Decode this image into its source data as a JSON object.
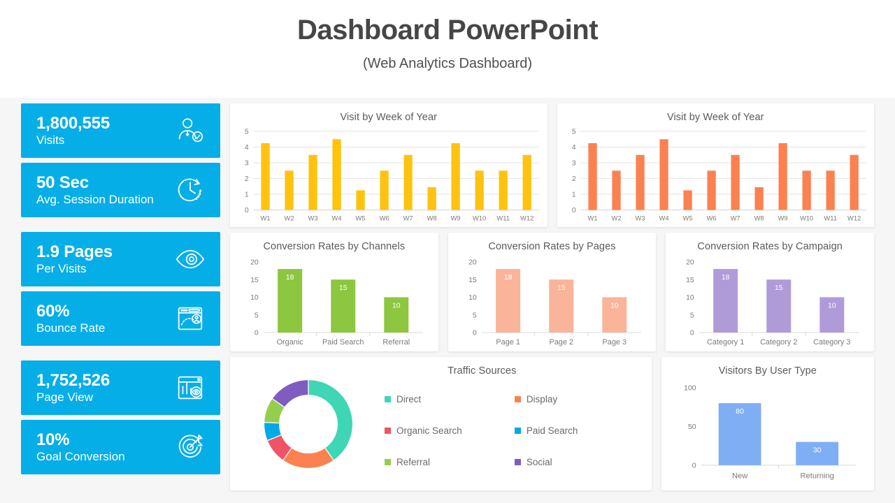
{
  "header": {
    "title": "Dashboard PowerPoint",
    "subtitle": "(Web Analytics Dashboard)"
  },
  "theme": {
    "accent": "#06AEE8",
    "page_bg": "#FFFFFF",
    "board_bg": "#F6F6F6",
    "panel_bg": "#FFFFFF",
    "title_color": "#464646"
  },
  "kpis": [
    {
      "value": "1,800,555",
      "label": "Visits",
      "icon": "user-check-icon"
    },
    {
      "value": "50 Sec",
      "label": "Avg. Session Duration",
      "icon": "clock-timer-icon"
    },
    {
      "value": "1.9 Pages",
      "label": "Per Visits",
      "icon": "eye-icon"
    },
    {
      "value": "60%",
      "label": "Bounce Rate",
      "icon": "browser-bounce-icon"
    },
    {
      "value": "1,752,526",
      "label": "Page View",
      "icon": "chart-eye-icon"
    },
    {
      "value": "10%",
      "label": "Goal Conversion",
      "icon": "target-arrow-icon"
    }
  ],
  "chart_data": [
    {
      "id": "visit_week_yellow",
      "type": "bar",
      "title": "Visit by Week of Year",
      "categories": [
        "W1",
        "W2",
        "W3",
        "W4",
        "W5",
        "W6",
        "W7",
        "W8",
        "W9",
        "W10",
        "W11",
        "W12"
      ],
      "values": [
        4.25,
        2.5,
        3.5,
        4.5,
        1.25,
        2.5,
        3.5,
        1.45,
        4.25,
        2.5,
        2.5,
        3.5
      ],
      "color": "#FFC20E",
      "ylim": [
        0,
        5
      ],
      "yticks": [
        0,
        1,
        2,
        3,
        4,
        5
      ],
      "xlabel": "",
      "ylabel": "",
      "grid": true,
      "legend": false,
      "data_labels": false
    },
    {
      "id": "visit_week_orange",
      "type": "bar",
      "title": "Visit by Week of Year",
      "categories": [
        "W1",
        "W2",
        "W3",
        "W4",
        "W5",
        "W6",
        "W7",
        "W8",
        "W9",
        "W10",
        "W11",
        "W12"
      ],
      "values": [
        4.25,
        2.5,
        3.5,
        4.5,
        1.25,
        2.5,
        3.5,
        1.45,
        4.25,
        2.5,
        2.5,
        3.5
      ],
      "color": "#FB8150",
      "ylim": [
        0,
        5
      ],
      "yticks": [
        0,
        1,
        2,
        3,
        4,
        5
      ],
      "xlabel": "",
      "ylabel": "",
      "grid": true,
      "legend": false,
      "data_labels": false
    },
    {
      "id": "conv_channels",
      "type": "bar",
      "title": "Conversion Rates by Channels",
      "categories": [
        "Organic",
        "Paid Search",
        "Referral"
      ],
      "values": [
        18,
        15,
        10
      ],
      "color": "#8DC63F",
      "ylim": [
        0,
        20
      ],
      "yticks": [
        0,
        5,
        10,
        15,
        20
      ],
      "xlabel": "",
      "ylabel": "",
      "grid": false,
      "legend": false,
      "data_labels": true
    },
    {
      "id": "conv_pages",
      "type": "bar",
      "title": "Conversion Rates by Pages",
      "categories": [
        "Page 1",
        "Page 2",
        "Page 3"
      ],
      "values": [
        18,
        15,
        10
      ],
      "color": "#F9B49A",
      "ylim": [
        0,
        20
      ],
      "yticks": [
        0,
        5,
        10,
        15,
        20
      ],
      "xlabel": "",
      "ylabel": "",
      "grid": false,
      "legend": false,
      "data_labels": true
    },
    {
      "id": "conv_campaign",
      "type": "bar",
      "title": "Conversion Rates by Campaign",
      "categories": [
        "Category 1",
        "Category 2",
        "Category 3"
      ],
      "values": [
        18,
        15,
        10
      ],
      "color": "#B09BD9",
      "ylim": [
        0,
        20
      ],
      "yticks": [
        0,
        5,
        10,
        15,
        20
      ],
      "xlabel": "",
      "ylabel": "",
      "grid": false,
      "legend": false,
      "data_labels": true
    },
    {
      "id": "traffic_sources",
      "type": "pie",
      "title": "Traffic Sources",
      "categories": [
        "Direct",
        "Display",
        "Organic Search",
        "Paid Search",
        "Referral",
        "Social"
      ],
      "values": [
        40.3,
        19.4,
        9.2,
        6.7,
        9.2,
        15.2
      ],
      "colors": [
        "#3ED6B4",
        "#FB8150",
        "#EF5466",
        "#00A9E8",
        "#95CE4F",
        "#7F5CC0"
      ],
      "legend": true,
      "legend_position": "right",
      "donut": true
    },
    {
      "id": "visitors_user_type",
      "type": "bar",
      "title": "Visitors By User Type",
      "categories": [
        "New",
        "Returning"
      ],
      "values": [
        80,
        30
      ],
      "color": "#7FAEF4",
      "ylim": [
        0,
        100
      ],
      "yticks": [
        0,
        50,
        100
      ],
      "xlabel": "",
      "ylabel": "",
      "grid": false,
      "legend": false,
      "data_labels": true
    }
  ]
}
